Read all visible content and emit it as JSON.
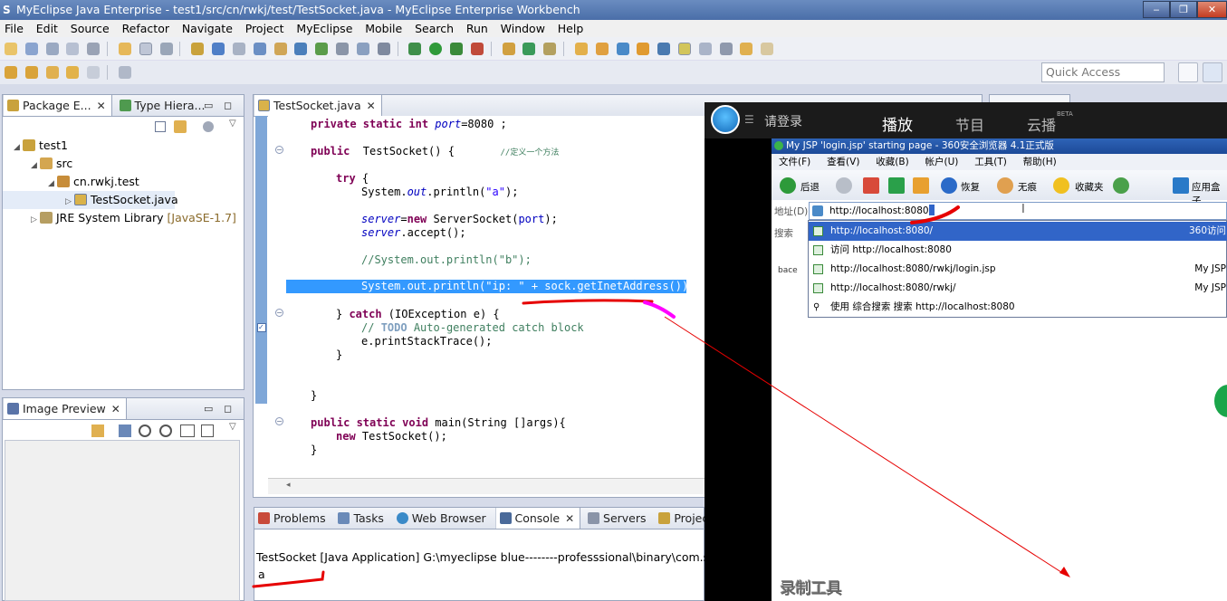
{
  "window": {
    "title": "MyEclipse Java Enterprise - test1/src/cn/rwkj/test/TestSocket.java - MyEclipse Enterprise Workbench",
    "minimize": "‒",
    "maximize": "❐",
    "close": "✕"
  },
  "menu": [
    "File",
    "Edit",
    "Source",
    "Refactor",
    "Navigate",
    "Project",
    "MyEclipse",
    "Mobile",
    "Search",
    "Run",
    "Window",
    "Help"
  ],
  "quick_access": {
    "placeholder": "Quick Access"
  },
  "package_explorer": {
    "tabs": [
      {
        "label": "Package E..."
      },
      {
        "label": "Type Hiera..."
      }
    ],
    "tree": [
      {
        "label": "test1"
      },
      {
        "label": "src"
      },
      {
        "label": "cn.rwkj.test"
      },
      {
        "label": "TestSocket.java"
      },
      {
        "label": "JRE System Library",
        "suffix": "[JavaSE-1.7]"
      }
    ]
  },
  "image_preview": {
    "tab": "Image Preview"
  },
  "editor": {
    "tab": "TestSocket.java",
    "code": {
      "l1_kw": "private static int ",
      "l1_field": "port",
      "l1_rest": "=8080 ;",
      "l2_kw": "public  ",
      "l2_rest": "TestSocket() {       ",
      "l2_comment": "//定义一个方法",
      "l3_kw": "try",
      "l3_rest": " {",
      "l4_a": "System.",
      "l4_out": "out",
      "l4_b": ".println(",
      "l4_str": "\"a\"",
      "l4_c": ");",
      "l5_field": "server",
      "l5_a": "=",
      "l5_kw": "new",
      "l5_b": " ServerSocket(",
      "l5_port": "port",
      "l5_c": ");",
      "l6_field": "server",
      "l6_rest": ".accept();",
      "l7_comment": "//System.out.println(\"b\");",
      "l8_full": "System.out.println(\"ip: \" + sock.getInetAddress());",
      "l9_a": "} ",
      "l9_kw": "catch",
      "l9_b": " (IOException e) {",
      "l10_comment": "// ",
      "l10_todo": "TODO",
      "l10_rest": " Auto-generated catch block",
      "l11": "e.printStackTrace();",
      "l12": "}",
      "l13": "}",
      "l14_kw": "public static void ",
      "l14_rest": "main(String []args){",
      "l15_kw": "new",
      "l15_rest": " TestSocket();",
      "l16": "}"
    }
  },
  "bottom_tabs": [
    {
      "label": "Problems"
    },
    {
      "label": "Tasks"
    },
    {
      "label": "Web Browser"
    },
    {
      "label": "Console"
    },
    {
      "label": "Servers"
    },
    {
      "label": "Project Migrati"
    }
  ],
  "console": {
    "header": "TestSocket [Java Application] G:\\myeclipse blue--------professsional\\binary\\com.sun.j",
    "output": "a"
  },
  "recorder": {
    "login": "请登录",
    "tab_play": "播放",
    "tab_program": "节目",
    "tab_cloud": "云播",
    "beta": "BETA",
    "watermark": "录制工具"
  },
  "browser": {
    "title": "My JSP 'login.jsp' starting page - 360安全浏览器 4.1正式版",
    "menu": [
      "文件(F)",
      "查看(V)",
      "收藏(B)",
      "帐户(U)",
      "工具(T)",
      "帮助(H)"
    ],
    "back": "后退",
    "restore": "恢复",
    "trace": "无痕",
    "favorites": "收藏夹",
    "app_box": "应用盒子",
    "addr_label": "地址(D)",
    "search_label": "搜索",
    "address": "http://localhost:8080",
    "side_text": "bace",
    "dropdown": [
      {
        "text": "http://localhost:8080/",
        "right": "360访问"
      },
      {
        "text": "访问  http://localhost:8080",
        "right": ""
      },
      {
        "text": "http://localhost:8080/rwkj/login.jsp",
        "right": "My JSP"
      },
      {
        "text": "http://localhost:8080/rwkj/",
        "right": "My JSP"
      },
      {
        "text": "使用 综合搜索 搜索 http://localhost:8080",
        "right": ""
      }
    ]
  },
  "colors": {
    "title_bar": "#4a6ea8",
    "selection": "#3399ff",
    "annotation_red": "#e60000",
    "annotation_magenta": "#ff00ff"
  }
}
